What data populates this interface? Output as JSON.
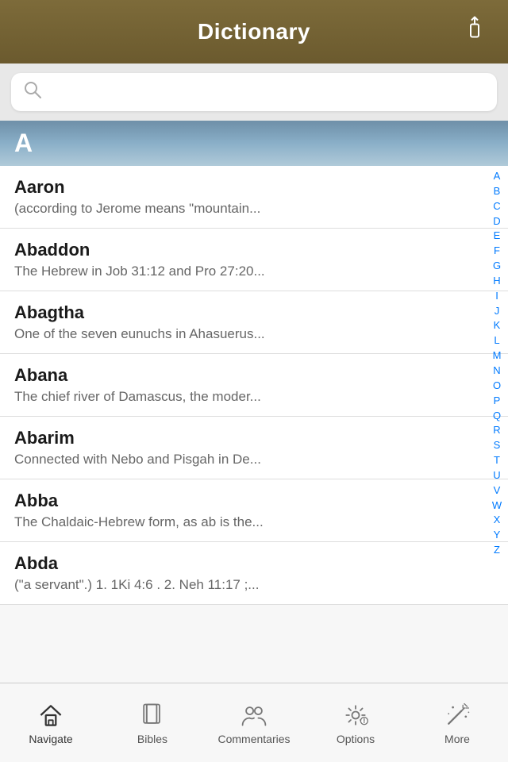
{
  "header": {
    "title": "Dictionary",
    "share_icon": "↑"
  },
  "search": {
    "placeholder": ""
  },
  "section": {
    "letter": "A"
  },
  "entries": [
    {
      "title": "Aaron",
      "description": "(according to Jerome means \"mountain..."
    },
    {
      "title": "Abaddon",
      "description": "The Hebrew in Job 31:12 and Pro 27:20..."
    },
    {
      "title": "Abagtha",
      "description": "One of the seven eunuchs in Ahasuerus..."
    },
    {
      "title": "Abana",
      "description": "The chief river of Damascus, the moder..."
    },
    {
      "title": "Abarim",
      "description": "Connected with Nebo and Pisgah in De..."
    },
    {
      "title": "Abba",
      "description": "The Chaldaic-Hebrew form, as ab is the..."
    },
    {
      "title": "Abda",
      "description": "(\"a servant\".) 1. 1Ki 4:6 . 2. Neh 11:17 ;..."
    }
  ],
  "alphabet": [
    "A",
    "B",
    "C",
    "D",
    "E",
    "F",
    "G",
    "H",
    "I",
    "J",
    "K",
    "L",
    "M",
    "N",
    "O",
    "P",
    "Q",
    "R",
    "S",
    "T",
    "U",
    "V",
    "W",
    "X",
    "Y",
    "Z"
  ],
  "tabs": [
    {
      "id": "navigate",
      "label": "Navigate",
      "active": true
    },
    {
      "id": "bibles",
      "label": "Bibles",
      "active": false
    },
    {
      "id": "commentaries",
      "label": "Commentaries",
      "active": false
    },
    {
      "id": "options",
      "label": "Options",
      "active": false
    },
    {
      "id": "more",
      "label": "More",
      "active": false
    }
  ]
}
